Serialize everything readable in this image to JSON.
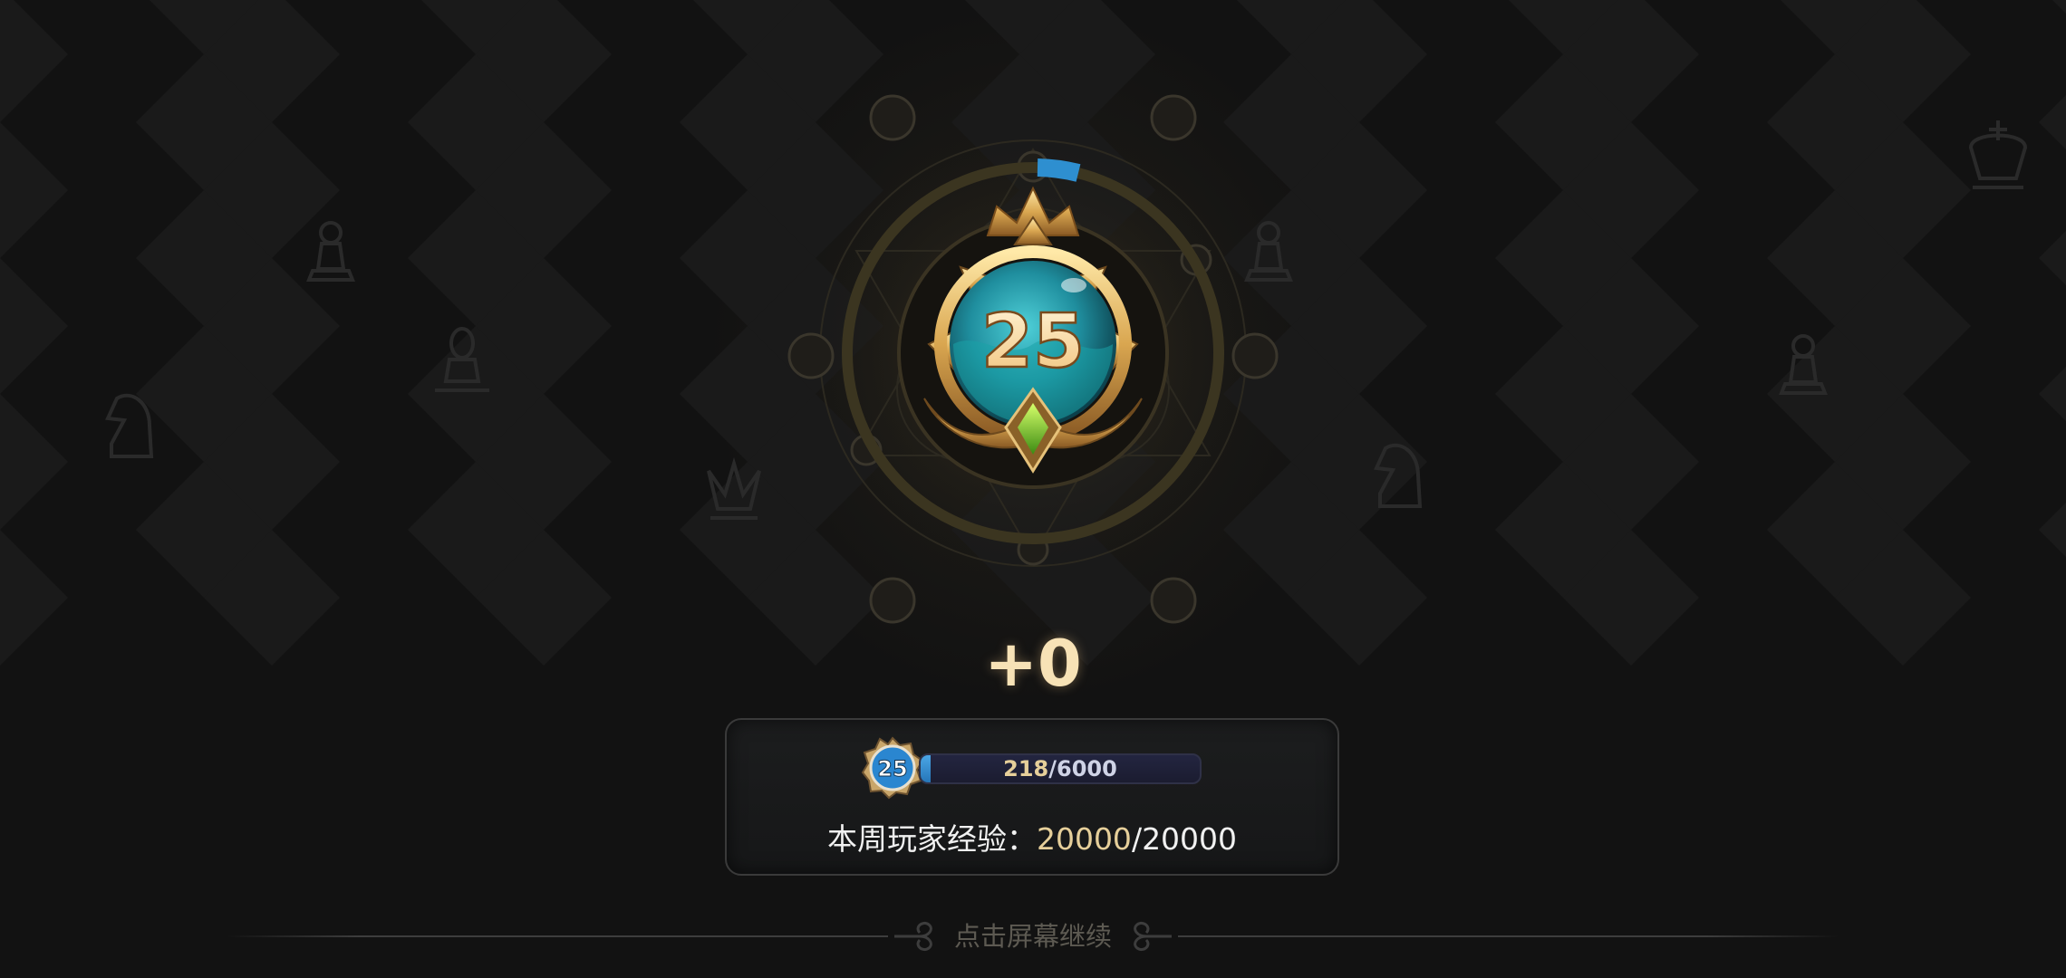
{
  "colors": {
    "background": "#121212",
    "gold_text": "#e6cf9a",
    "gain_text": "#f7e2b6",
    "progress_blue": "#3b93d6",
    "panel_border": "#3a3a3a",
    "orb_teal": "#1f8e9e",
    "gem_green": "#8fd13a"
  },
  "emblem": {
    "level": "25",
    "icon": "crowned-orb-level-emblem",
    "ring_progress": 0.036
  },
  "result": {
    "exp_gain": "+0"
  },
  "level_progress": {
    "badge_level": "25",
    "current": "218",
    "separator": "/",
    "max": "6000",
    "fraction": 0.036
  },
  "weekly_exp": {
    "label": "本周玩家经验：",
    "current": "20000",
    "separator": "/",
    "max": "20000"
  },
  "footer": {
    "continue_hint": "点击屏幕继续"
  }
}
